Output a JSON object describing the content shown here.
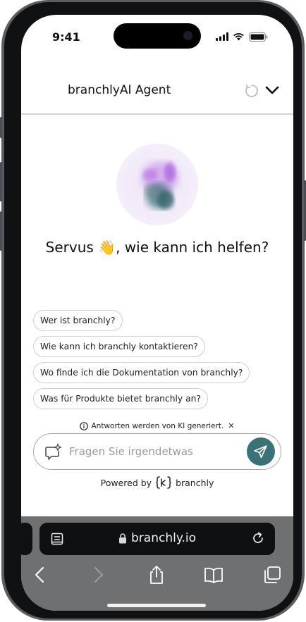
{
  "status_bar": {
    "time": "9:41",
    "icons": [
      "signal-icon",
      "wifi-icon",
      "battery-icon"
    ]
  },
  "chat": {
    "header": {
      "title": "branchlyAI Agent",
      "icons": [
        "reload-icon",
        "chevron-down-icon"
      ]
    },
    "greeting": "Servus 👋, wie kann ich helfen?",
    "suggestions": [
      "Wer ist branchly?",
      "Wie kann ich branchly kontaktieren?",
      "Wo finde ich die Dokumentation von branchly?",
      "Was für Produkte bietet branchly an?"
    ],
    "disclaimer": "Antworten werden von KI generiert.",
    "input": {
      "placeholder": "Fragen Sie irgendetwas",
      "value": ""
    },
    "powered_by": {
      "label": "Powered by",
      "brand": "branchly"
    },
    "colors": {
      "send_button": "#3b7278",
      "avatar_accent": "#a46cd8"
    }
  },
  "browser": {
    "url": "branchly.io",
    "toolbar": [
      "back-icon",
      "forward-icon",
      "share-icon",
      "bookmarks-icon",
      "tabs-icon"
    ]
  }
}
